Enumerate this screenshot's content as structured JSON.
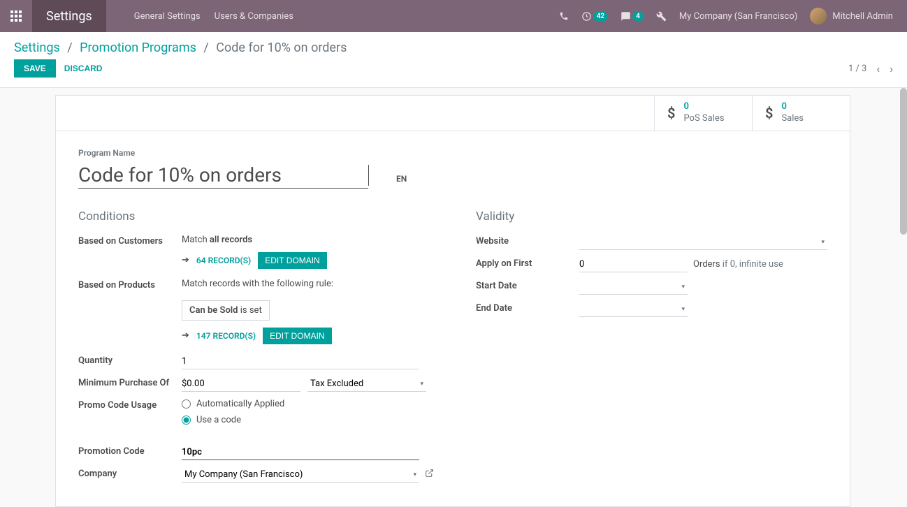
{
  "nav": {
    "brand": "Settings",
    "links": {
      "general": "General Settings",
      "users": "Users & Companies"
    },
    "activities_badge": "42",
    "messages_badge": "4",
    "company": "My Company (San Francisco)",
    "user": "Mitchell Admin"
  },
  "breadcrumb": {
    "root": "Settings",
    "mid": "Promotion Programs",
    "current": "Code for 10% on orders"
  },
  "actions": {
    "save": "SAVE",
    "discard": "DISCARD"
  },
  "pager": {
    "text": "1 / 3"
  },
  "stats": {
    "pos": {
      "value": "0",
      "label": "PoS Sales"
    },
    "sales": {
      "value": "0",
      "label": "Sales"
    }
  },
  "form": {
    "program_name_label": "Program Name",
    "program_name_value": "Code for 10% on orders",
    "lang": "EN"
  },
  "conditions": {
    "heading": "Conditions",
    "based_customers_label": "Based on Customers",
    "match_prefix": "Match ",
    "match_all": "all records",
    "records_64": "64 RECORD(S)",
    "edit_domain": "EDIT DOMAIN",
    "based_products_label": "Based on Products",
    "match_rule_text": "Match records with the following rule:",
    "rule_field": "Can be Sold",
    "rule_op": " is set",
    "records_147": "147 RECORD(S)",
    "quantity_label": "Quantity",
    "quantity_value": "1",
    "min_purchase_label": "Minimum Purchase Of",
    "min_purchase_value": "$0.00",
    "tax_option": "Tax Excluded",
    "promo_usage_label": "Promo Code Usage",
    "auto_applied": "Automatically Applied",
    "use_code": "Use a code",
    "promotion_code_label": "Promotion Code",
    "promotion_code_value": "10pc",
    "company_label": "Company",
    "company_value": "My Company (San Francisco)"
  },
  "validity": {
    "heading": "Validity",
    "website_label": "Website",
    "apply_label": "Apply on First",
    "apply_value": "0",
    "orders_strong": "Orders",
    "orders_note_rest": " if 0, infinite use",
    "start_label": "Start Date",
    "end_label": "End Date"
  }
}
